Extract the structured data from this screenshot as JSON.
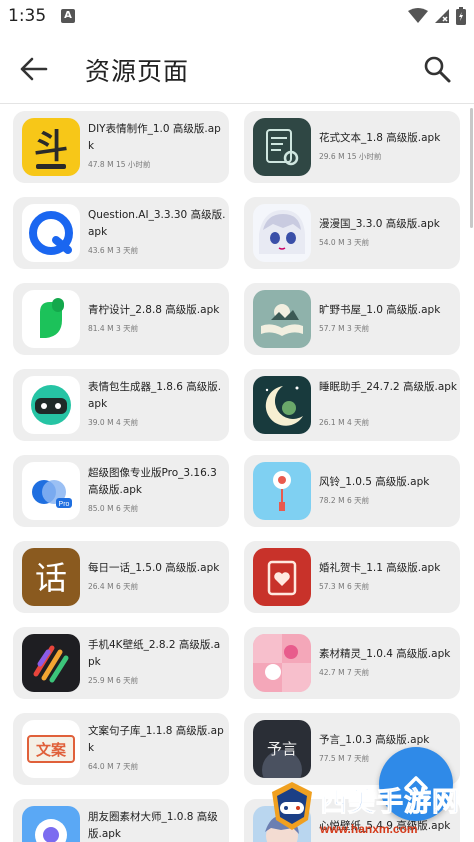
{
  "status_bar": {
    "time": "1:35",
    "notification_letter": "A"
  },
  "app_bar": {
    "title": "资源页面"
  },
  "files": [
    {
      "name": "DIY表情制作_1.0 高级版.apk",
      "size": "47.8 M",
      "age": "15 小时前",
      "icon": "doutu-icon"
    },
    {
      "name": "花式文本_1.8 高级版.apk",
      "size": "29.6 M",
      "age": "15 小时前",
      "icon": "fancy-text-icon"
    },
    {
      "name": "Question.AI_3.3.30 高级版.apk",
      "size": "43.6 M",
      "age": "3 天前",
      "icon": "question-ai-icon"
    },
    {
      "name": "漫漫国_3.3.0 高级版.apk",
      "size": "54.0 M",
      "age": "3 天前",
      "icon": "anime-girl-icon"
    },
    {
      "name": "青柠设计_2.8.8 高级版.apk",
      "size": "81.4 M",
      "age": "3 天前",
      "icon": "green-leaf-icon"
    },
    {
      "name": "旷野书屋_1.0 高级版.apk",
      "size": "57.7 M",
      "age": "3 天前",
      "icon": "open-book-icon"
    },
    {
      "name": "表情包生成器_1.8.6 高级版.apk",
      "size": "39.0 M",
      "age": "4 天前",
      "icon": "panda-face-icon"
    },
    {
      "name": "睡眠助手_24.7.2 高级版.apk",
      "size": "26.1 M",
      "age": "4 天前",
      "icon": "moon-night-icon"
    },
    {
      "name": "超级图像专业版Pro_3.16.3 高级版.apk",
      "size": "85.0 M",
      "age": "6 天前",
      "icon": "image-pro-icon"
    },
    {
      "name": "风铃_1.0.5 高级版.apk",
      "size": "78.2 M",
      "age": "6 天前",
      "icon": "wind-chime-icon"
    },
    {
      "name": "每日一话_1.5.0 高级版.apk",
      "size": "26.4 M",
      "age": "6 天前",
      "icon": "hua-character-icon"
    },
    {
      "name": "婚礼贺卡_1.1 高级版.apk",
      "size": "57.3 M",
      "age": "6 天前",
      "icon": "wedding-card-icon"
    },
    {
      "name": "手机4K壁纸_2.8.2 高级版.apk",
      "size": "25.9 M",
      "age": "6 天前",
      "icon": "stripes-wallpaper-icon"
    },
    {
      "name": "素材精灵_1.0.4 高级版.apk",
      "size": "42.7 M",
      "age": "7 天前",
      "icon": "pink-collage-icon"
    },
    {
      "name": "文案句子库_1.1.8 高级版.apk",
      "size": "64.0 M",
      "age": "7 天前",
      "icon": "wenan-stamp-icon"
    },
    {
      "name": "予言_1.0.3 高级版.apk",
      "size": "77.5 M",
      "age": "7 天前",
      "icon": "yuyan-night-icon"
    },
    {
      "name": "朋友圈素材大师_1.0.8 高级版.apk",
      "size": "",
      "age": "",
      "icon": "aperture-icon"
    },
    {
      "name": "心悦壁纸_5.4.9 高级版.apk",
      "size": "",
      "age": "",
      "icon": "girl-portrait-icon"
    }
  ],
  "watermark": {
    "title": "西美手游网",
    "url": "www.hanxm.com"
  },
  "colors": {
    "card": "#eeeeee",
    "fab": "#2f8ae8",
    "watermark_title": "#1e6fd9",
    "watermark_url": "#d43a1a"
  }
}
